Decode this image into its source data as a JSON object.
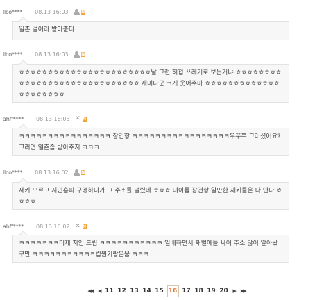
{
  "comments": [
    {
      "user": "llco****",
      "date": "08.13 16:03",
      "user_icon": "user-icon",
      "text": "일촌 걸어라 받아준다"
    },
    {
      "user": "llco****",
      "date": "08.13 16:03",
      "user_icon": "user-icon",
      "text": "ㅎㅎㅎㅎㅎㅎㅎㅎㅎㅎㅎㅎㅎㅎㅎㅎㅎㅎㅎㅎㅎㅎㅎ날 그런 허접 쓰레기로 보는거냐 ㅎㅎㅎㅎㅎㅎㅎㅎㅎㅎㅎㅎㅎㅎㅎㅎㅎㅎㅎㅎㅎㅎㅎㅎㅎㅎㅎㅎㅎ 재미나군 크게 웃어주마 ㅎㅎㅎㅎㅎㅎㅎㅎㅎㅎㅎㅎㅎㅎㅎㅎㅎㅎㅎㅎㅎ"
    },
    {
      "user": "ahff****",
      "date": "08.13 16:03",
      "user_icon": "x-icon",
      "text": "ㅋㅋㅋㅋㅋㅋㅋㅋㅋㅋㅋㅋㅋㅋㅋㅋ 장건항 ㅋㅋㅋㅋㅋㅋㅋㅋㅋㅋㅋㅋㅋㅋㅋㅋㅋ우쭈쭈 그러셨어요? 그러면 일촌좀 받아주지 ㅋㅋㅋ"
    },
    {
      "user": "llco****",
      "date": "08.13 16:02",
      "user_icon": "user-icon",
      "text": "새키 모르고 지인홈피 구경하다가 그 주소를 널렸네 ㅎㅎㅎ 내이름 장건항 알만한 새키들은 다 안다 ㅎㅎㅎㅎ"
    },
    {
      "user": "ahff****",
      "date": "08.13 16:02",
      "user_icon": "x-icon",
      "text": "ㅋㅋㅋㅋㅋㅋㅋ미제 지인 드립 ㅋㅋㅋㅋㅋㅋㅋㅋㅋㅋㅋ 일베하면서 재벌애들 싸이 주소 많이 알아놨구만 ㅋㅋㅋㅋㅋㅋㅋㅋㅋㅋㅋ킵원기랑은뭄 ㅋㅋㅋ"
    }
  ],
  "badge_n": "N",
  "pagination": {
    "first": "◀◀",
    "prev": "◀",
    "pages": [
      "11",
      "12",
      "13",
      "14",
      "15",
      "16",
      "17",
      "18",
      "19",
      "20"
    ],
    "current": "16",
    "next": "▶",
    "last": "▶▶"
  }
}
